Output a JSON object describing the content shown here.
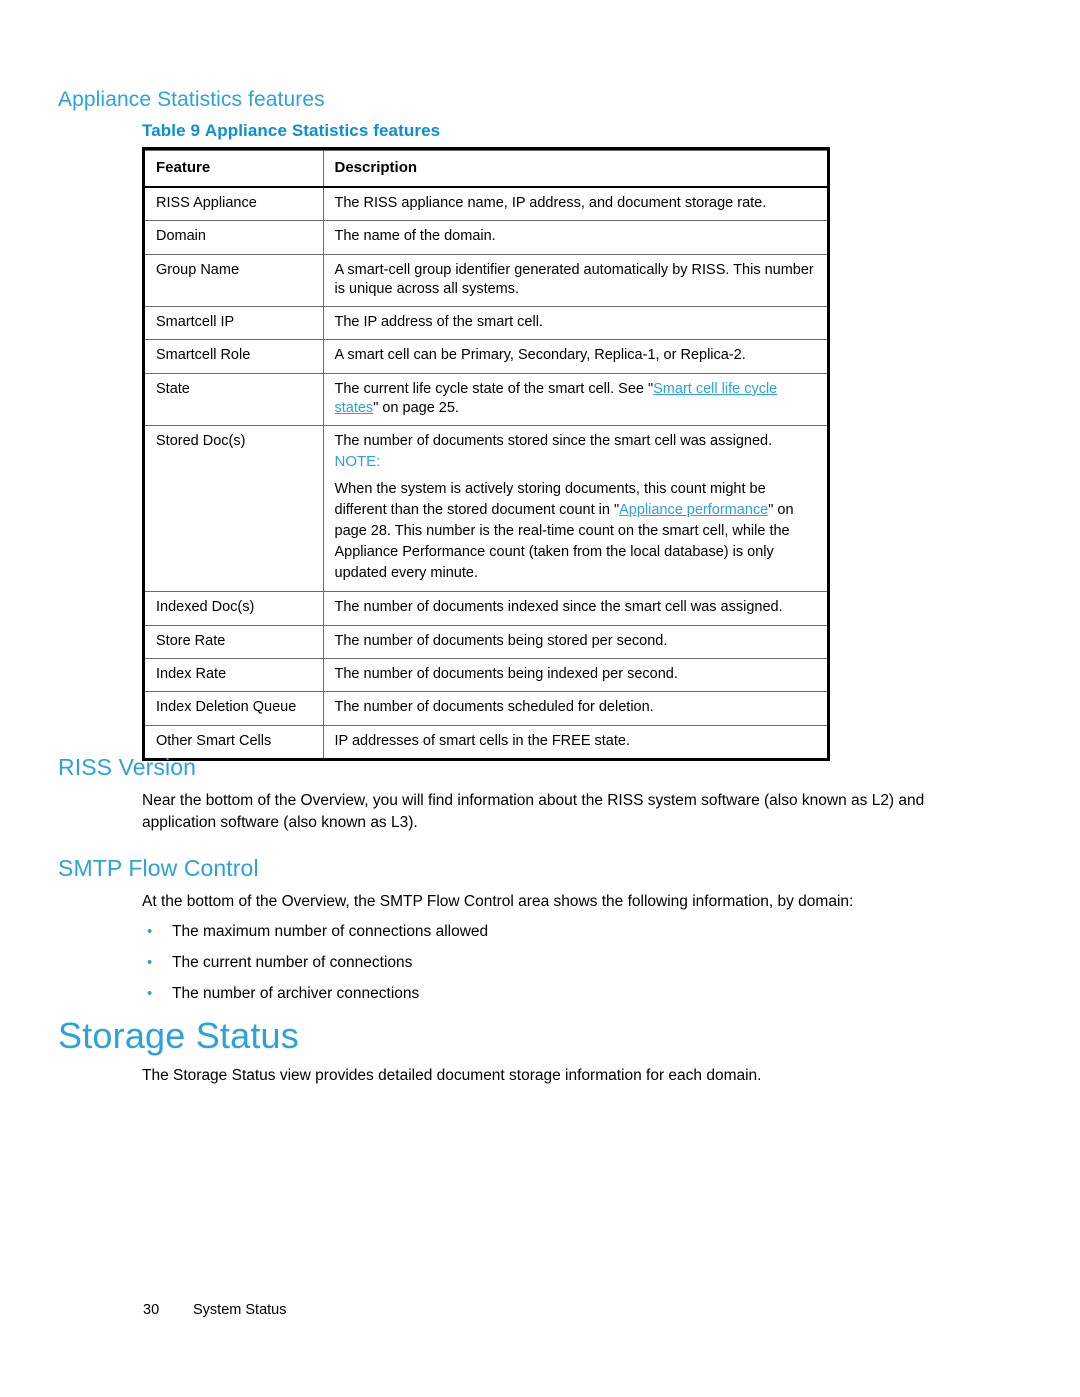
{
  "headings": {
    "appliance_statistics_features": "Appliance Statistics features",
    "riss_version": "RISS Version",
    "smtp_flow_control": "SMTP Flow Control",
    "storage_status": "Storage Status"
  },
  "table": {
    "caption_label": "Table 9",
    "caption_title": "Appliance Statistics features",
    "columns": [
      "Feature",
      "Description"
    ],
    "rows": [
      {
        "feature": "RISS Appliance",
        "description": "The RISS appliance name, IP address, and document storage rate."
      },
      {
        "feature": "Domain",
        "description": "The name of the domain."
      },
      {
        "feature": "Group Name",
        "description": "A smart-cell group identifier generated automatically by RISS. This number is unique across all systems."
      },
      {
        "feature": "Smartcell IP",
        "description": "The IP address of the smart cell."
      },
      {
        "feature": "Smartcell Role",
        "description": "A smart cell can be Primary, Secondary, Replica-1, or Replica-2."
      },
      {
        "feature": "State",
        "description_prefix": "The current life cycle state of the smart cell.  See \"",
        "link_text": "Smart cell life cycle states",
        "description_suffix": "\" on page 25."
      },
      {
        "feature": "Stored Doc(s)",
        "description_lead": "The number of documents stored since the smart cell was assigned.",
        "note_label": "NOTE:",
        "note_prefix": "When the system is actively storing documents, this count might be different than the stored document count in \"",
        "note_link": "Appliance performance",
        "note_suffix": "\" on page 28. This number is the real-time count on the smart cell, while the Appliance Performance count (taken from the local database) is only updated every minute."
      },
      {
        "feature": "Indexed Doc(s)",
        "description": "The number of documents indexed since the smart cell was assigned."
      },
      {
        "feature": "Store Rate",
        "description": "The number of documents being stored per second."
      },
      {
        "feature": "Index Rate",
        "description": "The number of documents being indexed per second."
      },
      {
        "feature": "Index Deletion Queue",
        "description": "The number of documents scheduled for deletion."
      },
      {
        "feature": "Other Smart Cells",
        "description": "IP addresses of smart cells in the FREE state."
      }
    ]
  },
  "body": {
    "riss_version_paragraph": "Near the bottom of the Overview, you will find information about the RISS system software (also known as L2) and application software (also known as L3).",
    "smtp_paragraph": "At the bottom of the Overview, the SMTP Flow Control area shows the following information, by domain:",
    "smtp_bullets": [
      "The maximum number of connections allowed",
      "The current number of connections",
      "The number of archiver connections"
    ],
    "storage_status_paragraph": "The Storage Status view provides detailed document storage information for each domain."
  },
  "footer": {
    "page_number": "30",
    "section_name": "System Status"
  },
  "colors": {
    "accent_blue": "#2aa3dc",
    "caption_blue": "#0b8fd4",
    "text_black": "#000000",
    "table_border": "#000000",
    "grid_line": "#6b6b6b"
  },
  "bullet_glyph": "•"
}
